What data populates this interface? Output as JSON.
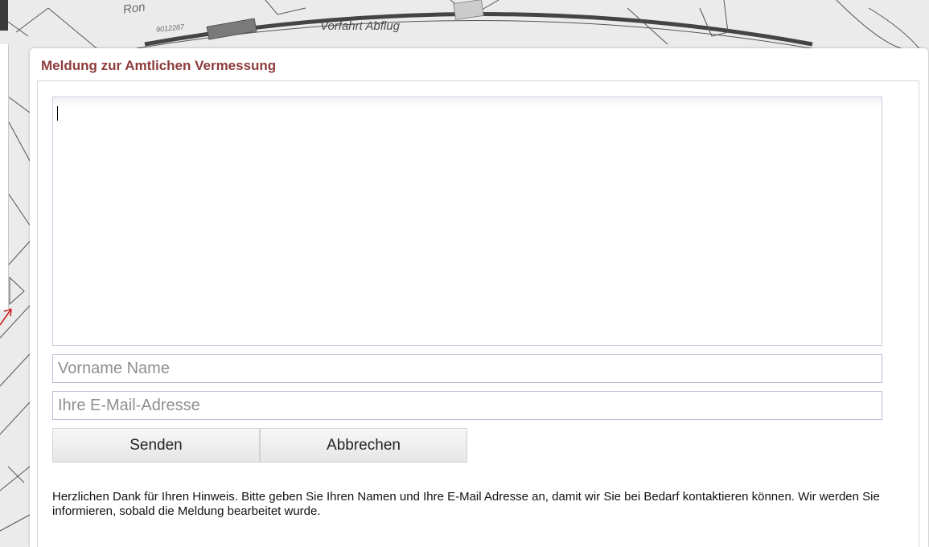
{
  "map": {
    "road_label": "Vorfahrt Abflug",
    "partial_label": "Ron",
    "parcel_number": "9012287"
  },
  "dialog": {
    "title": "Meldung zur Amtlichen Vermessung",
    "message_value": "",
    "name_placeholder": "Vorname Name",
    "email_placeholder": "Ihre E-Mail-Adresse",
    "send_label": "Senden",
    "cancel_label": "Abbrechen",
    "note": "Herzlichen Dank für Ihren Hinweis. Bitte geben Sie Ihren Namen und Ihre E-Mail Adresse an, damit wir Sie bei Bedarf kontaktieren können. Wir werden Sie informieren, sobald die Meldung bearbeitet wurde."
  },
  "colors": {
    "title": "#8e3b3b",
    "map_background": "#ebebeb",
    "map_marker": "#cc2222"
  }
}
